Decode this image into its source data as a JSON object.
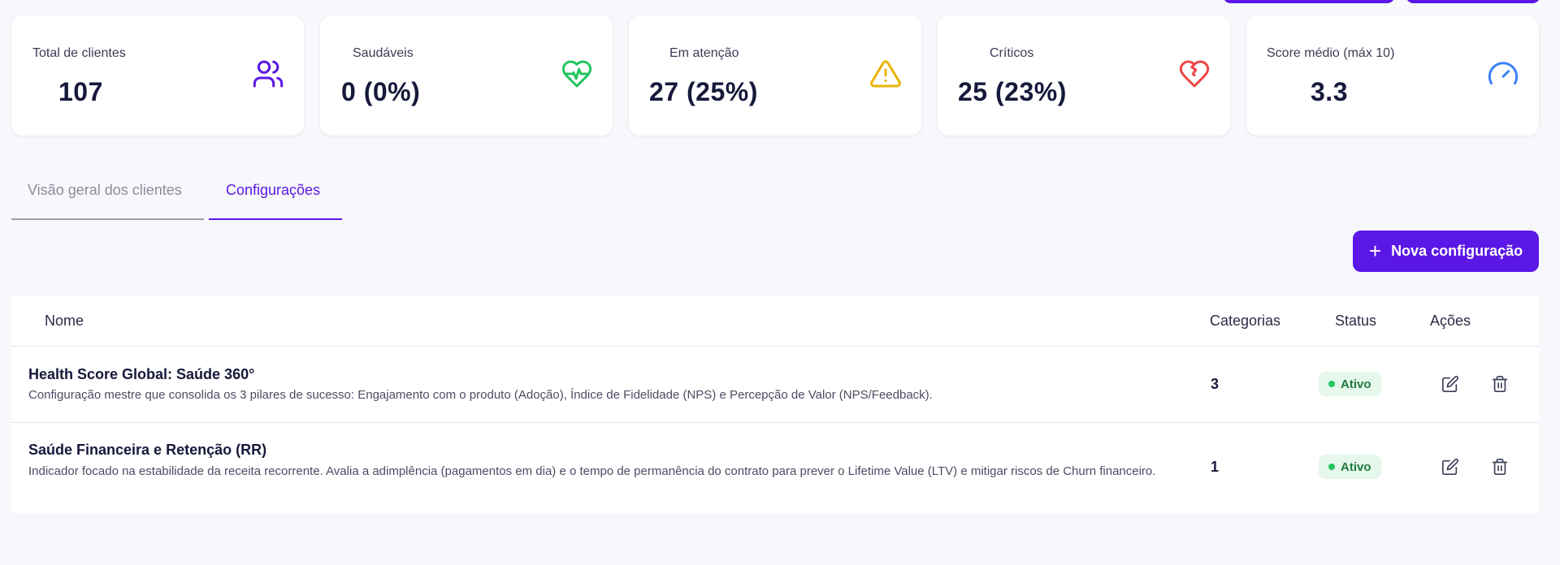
{
  "colors": {
    "accent": "#5b17e6",
    "healthy": "#22c55e",
    "warning": "#eab308",
    "critical": "#ef4444",
    "score": "#3b82f6"
  },
  "kpis": [
    {
      "label": "Total de clientes",
      "value": "107",
      "icon": "users-icon"
    },
    {
      "label": "Saudáveis",
      "value": "0 (0%)",
      "icon": "heart-pulse-icon"
    },
    {
      "label": "Em atenção",
      "value": "27 (25%)",
      "icon": "warning-icon"
    },
    {
      "label": "Críticos",
      "value": "25 (23%)",
      "icon": "heart-crack-icon"
    },
    {
      "label": "Score médio (máx 10)",
      "value": "3.3",
      "icon": "gauge-icon"
    }
  ],
  "tabs": [
    {
      "label": "Visão geral dos clientes",
      "active": false
    },
    {
      "label": "Configurações",
      "active": true
    }
  ],
  "new_button": {
    "label": "Nova configuração",
    "icon": "plus-icon"
  },
  "table": {
    "headers": {
      "name": "Nome",
      "categories": "Categorias",
      "status": "Status",
      "actions": "Ações"
    },
    "rows": [
      {
        "name": "Health Score Global: Saúde 360°",
        "description": "Configuração mestre que consolida os 3 pilares de sucesso: Engajamento com o produto (Adoção), Índice de Fidelidade (NPS) e Percepção de Valor (NPS/Feedback).",
        "categories": "3",
        "status": "Ativo"
      },
      {
        "name": "Saúde Financeira e Retenção (RR)",
        "description": "Indicador focado na estabilidade da receita recorrente. Avalia a adimplência (pagamentos em dia) e o tempo de permanência do contrato para prever o Lifetime Value (LTV) e mitigar riscos de Churn financeiro.",
        "categories": "1",
        "status": "Ativo"
      }
    ]
  }
}
